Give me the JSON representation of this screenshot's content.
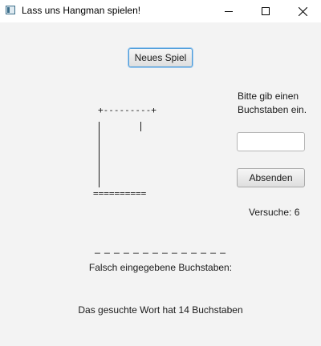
{
  "window": {
    "title": "Lass uns Hangman spielen!",
    "icon": "java-app-icon",
    "controls": [
      "minimize-icon",
      "maximize-icon",
      "close-icon"
    ]
  },
  "game": {
    "new_game_label": "Neues Spiel",
    "prompt": "Bitte gib einen Buchstaben ein.",
    "letter_input_value": "",
    "submit_label": "Absenden",
    "attempts_text": "Versuche: 6",
    "gallows_top": "+---------+",
    "gallows_base": "==========",
    "word_display": "_ _ _ _ _ _ _ _ _ _ _ _ _ _",
    "wrong_letters_label": "Falsch eingegebene Buchstaben:",
    "word_length_text": "Das gesuchte Wort hat 14 Buchstaben"
  },
  "colors": {
    "background": "#f3f3f3",
    "focus_accent": "#4c9cd9"
  }
}
